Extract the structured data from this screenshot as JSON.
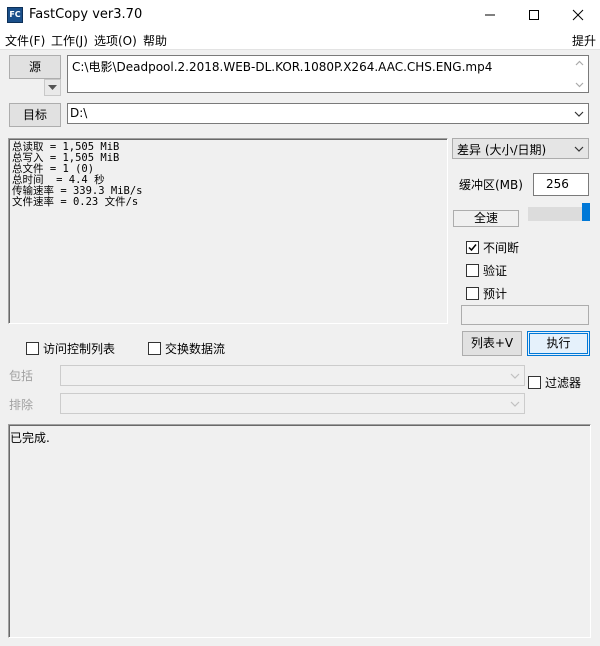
{
  "window": {
    "title": "FastCopy ver3.70",
    "icon_text": "FC",
    "minimize_icon": "minimize-icon",
    "maximize_icon": "maximize-icon",
    "close_icon": "close-icon"
  },
  "menu": {
    "items": [
      "文件(F)",
      "工作(J)",
      "选项(O)",
      "帮助"
    ],
    "right_item": "提升"
  },
  "source": {
    "button_label": "源",
    "path": "C:\\电影\\Deadpool.2.2018.WEB-DL.KOR.1080P.X264.AAC.CHS.ENG.mp4"
  },
  "target": {
    "button_label": "目标",
    "path": "D:\\"
  },
  "stats": {
    "lines": [
      "总读取 = 1,505 MiB",
      "总写入 = 1,505 MiB",
      "总文件 = 1 (0)",
      "总时间  = 4.4 秒",
      "传输速率 = 339.3 MiB/s",
      "文件速率 = 0.23 文件/s"
    ]
  },
  "options": {
    "mode_selected": "差异 (大小/日期)",
    "buffer_label": "缓冲区(MB)",
    "buffer_value": "256",
    "speed_label": "全速",
    "checkboxes": [
      {
        "label": "不间断",
        "checked": true
      },
      {
        "label": "验证",
        "checked": false
      },
      {
        "label": "预计",
        "checked": false
      }
    ],
    "speed_level": 1.0
  },
  "actions": {
    "list_label": "列表+V",
    "execute_label": "执行"
  },
  "extra": {
    "acl_label": "访问控制列表",
    "acl_checked": false,
    "stream_label": "交换数据流",
    "stream_checked": false,
    "include_label": "包括",
    "exclude_label": "排除",
    "filter_label": "过滤器",
    "filter_checked": false
  },
  "status": {
    "text": "已完成."
  }
}
